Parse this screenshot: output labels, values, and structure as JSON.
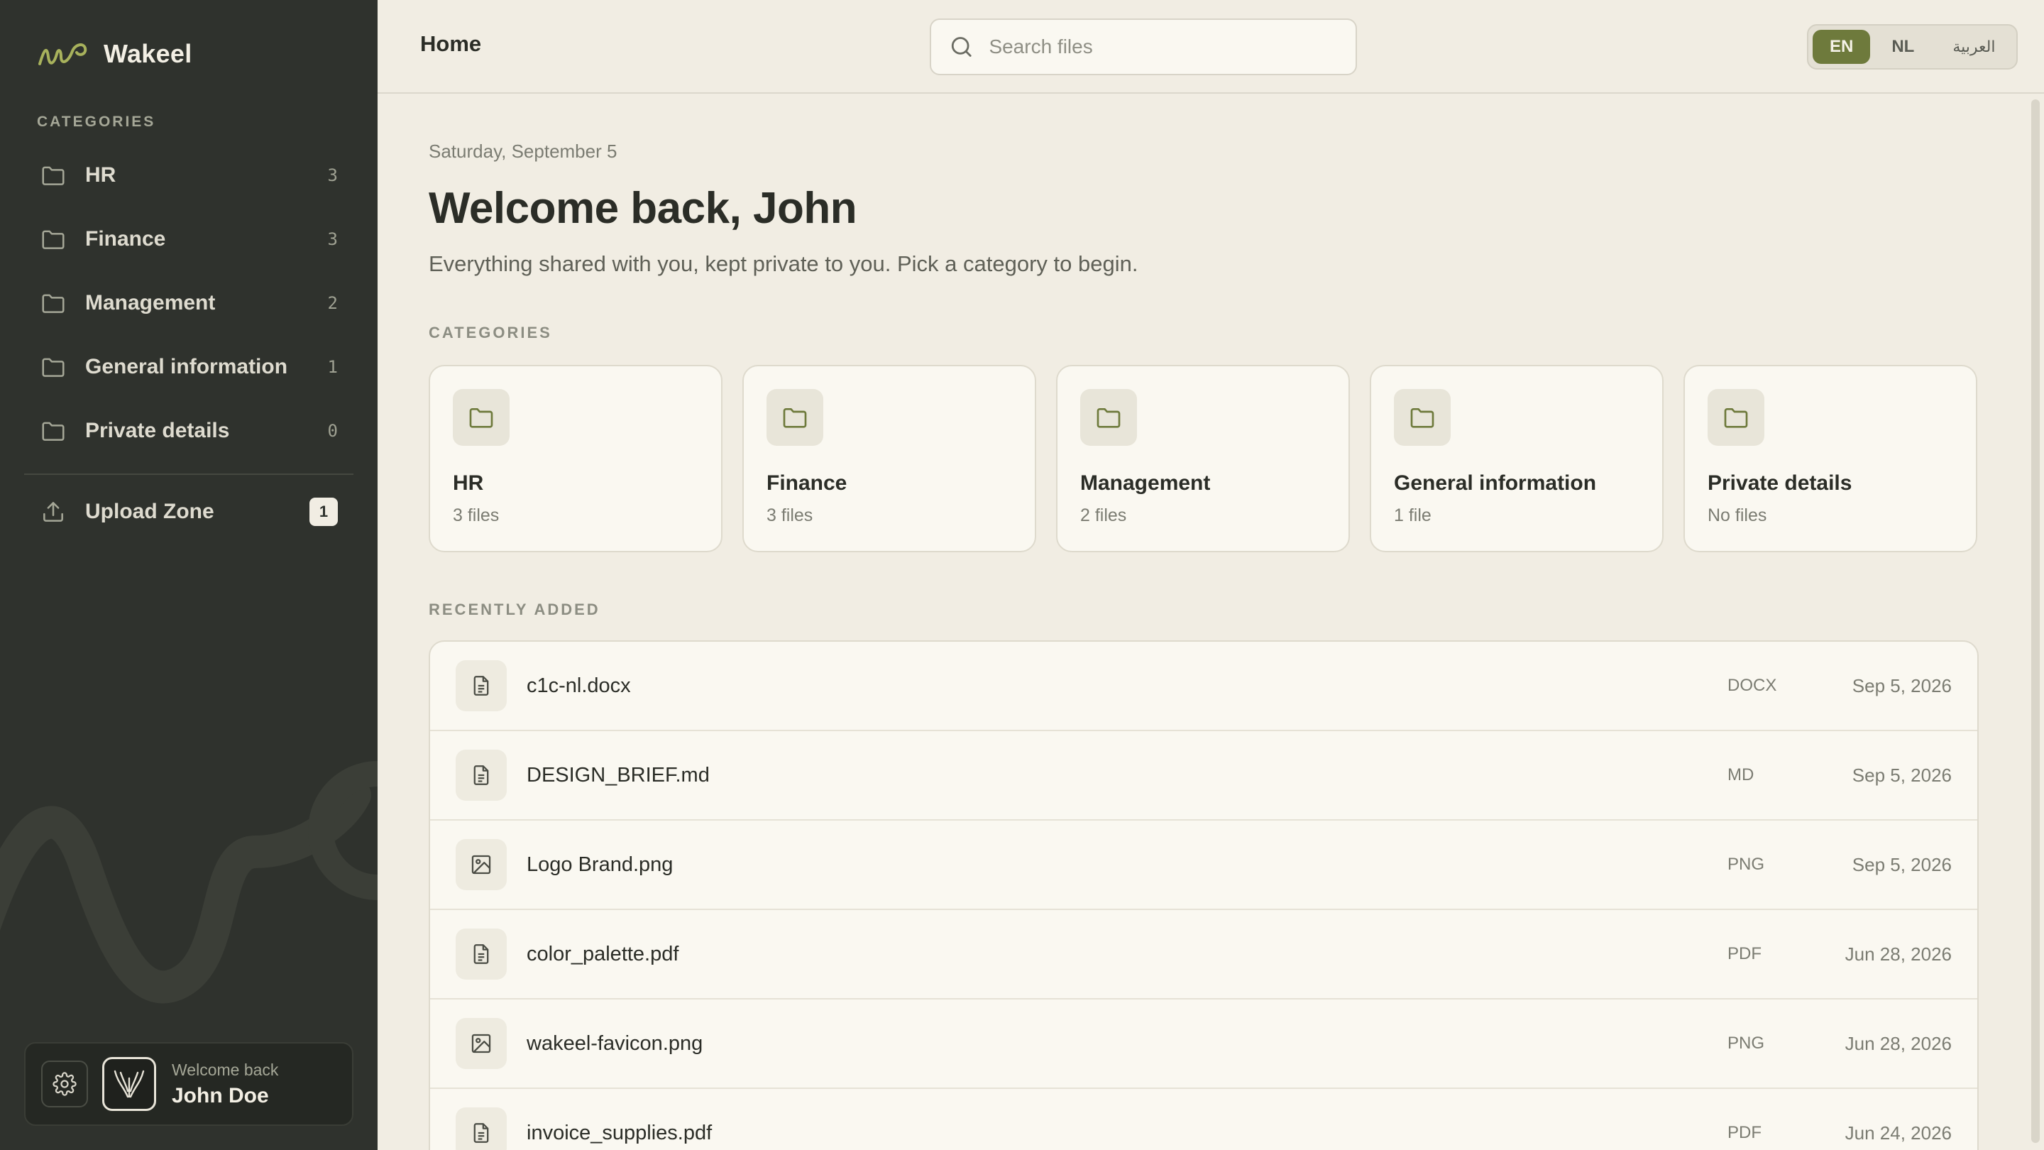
{
  "app": {
    "name": "Wakeel"
  },
  "sidebar": {
    "section_label": "CATEGORIES",
    "items": [
      {
        "label": "HR",
        "count": "3",
        "icon": "folder-icon"
      },
      {
        "label": "Finance",
        "count": "3",
        "icon": "folder-icon"
      },
      {
        "label": "Management",
        "count": "2",
        "icon": "folder-icon"
      },
      {
        "label": "General information",
        "count": "1",
        "icon": "folder-icon"
      },
      {
        "label": "Private details",
        "count": "0",
        "icon": "folder-icon"
      }
    ],
    "upload": {
      "label": "Upload Zone",
      "badge": "1",
      "icon": "upload-icon"
    },
    "user": {
      "greeting": "Welcome back",
      "name": "John Doe"
    }
  },
  "header": {
    "title": "Home",
    "search_placeholder": "Search files",
    "languages": [
      {
        "label": "EN",
        "active": true
      },
      {
        "label": "NL",
        "active": false
      },
      {
        "label": "العربية",
        "active": false
      }
    ]
  },
  "main": {
    "date": "Saturday, September 5",
    "welcome": "Welcome back, John",
    "subtitle": "Everything shared with you, kept private to you. Pick a category to begin.",
    "categories_label": "CATEGORIES",
    "categories": [
      {
        "name": "HR",
        "count": "3 files"
      },
      {
        "name": "Finance",
        "count": "3 files"
      },
      {
        "name": "Management",
        "count": "2 files"
      },
      {
        "name": "General information",
        "count": "1 file"
      },
      {
        "name": "Private details",
        "count": "No files"
      }
    ],
    "recent_label": "RECENTLY ADDED",
    "recent": [
      {
        "name": "c1c-nl.docx",
        "type": "DOCX",
        "date": "Sep 5, 2026",
        "icon": "document-icon"
      },
      {
        "name": "DESIGN_BRIEF.md",
        "type": "MD",
        "date": "Sep 5, 2026",
        "icon": "document-icon"
      },
      {
        "name": "Logo Brand.png",
        "type": "PNG",
        "date": "Sep 5, 2026",
        "icon": "image-icon"
      },
      {
        "name": "color_palette.pdf",
        "type": "PDF",
        "date": "Jun 28, 2026",
        "icon": "document-icon"
      },
      {
        "name": "wakeel-favicon.png",
        "type": "PNG",
        "date": "Jun 28, 2026",
        "icon": "image-icon"
      },
      {
        "name": "invoice_supplies.pdf",
        "type": "PDF",
        "date": "Jun 24, 2026",
        "icon": "document-icon"
      }
    ]
  },
  "colors": {
    "sidebar_bg": "#2f322d",
    "page_bg": "#f1ede3",
    "accent": "#6e7a3c",
    "card_bg": "#faf8f1"
  }
}
